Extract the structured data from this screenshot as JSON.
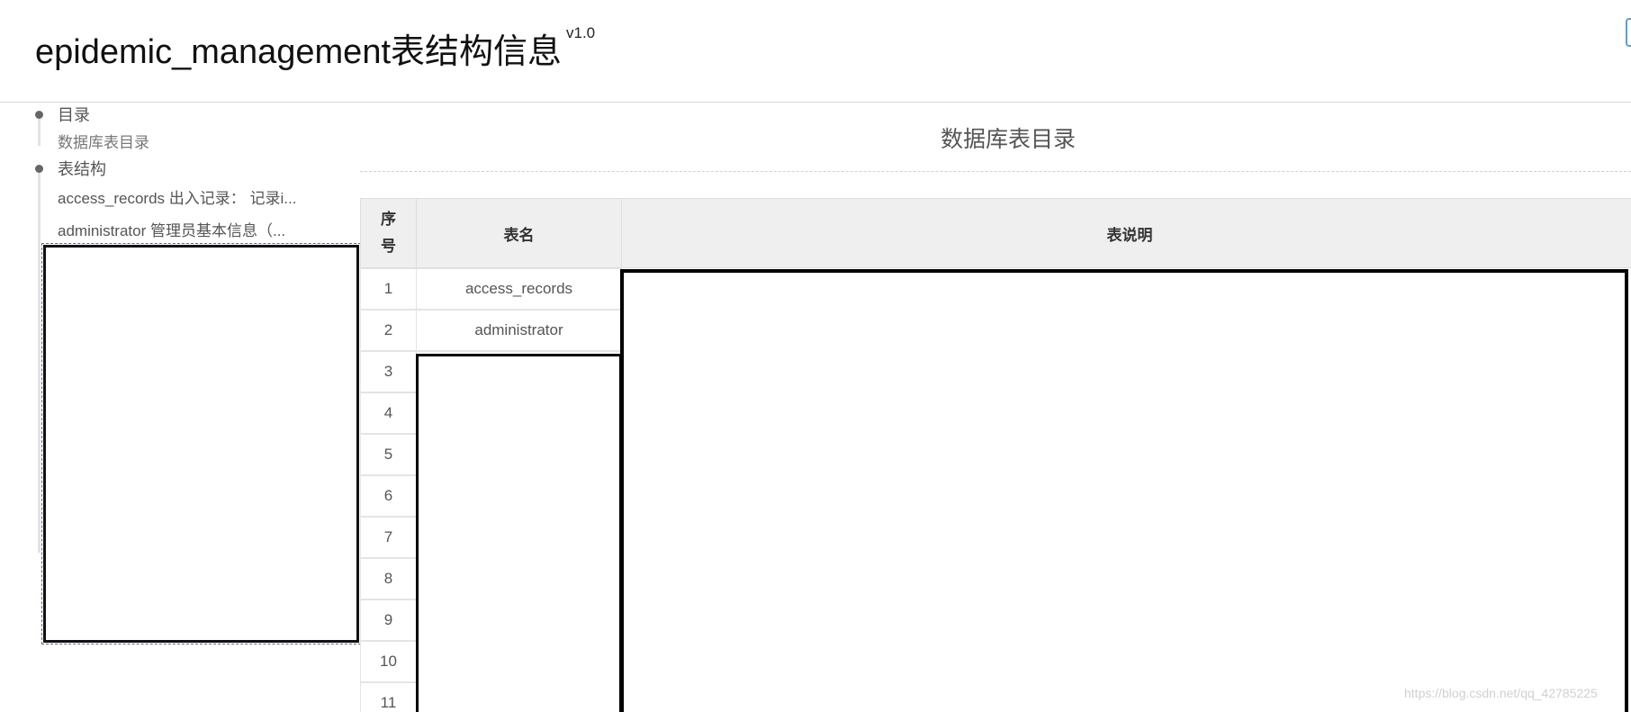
{
  "header": {
    "title": "epidemic_management表结构信息",
    "version": "v1.0"
  },
  "sidebar": {
    "toc_heading": "目录",
    "toc_sub": "数据库表目录",
    "structure_heading": "表结构",
    "items": [
      {
        "label": "access_records 出入记录： 记录i..."
      },
      {
        "label": "administrator 管理员基本信息（..."
      }
    ]
  },
  "main": {
    "title": "数据库表目录",
    "table": {
      "headers": [
        "序号",
        "表名",
        "表说明"
      ],
      "rows": [
        {
          "index": "1",
          "name": "access_records"
        },
        {
          "index": "2",
          "name": "administrator"
        },
        {
          "index": "3",
          "name": ""
        },
        {
          "index": "4",
          "name": ""
        },
        {
          "index": "5",
          "name": ""
        },
        {
          "index": "6",
          "name": ""
        },
        {
          "index": "7",
          "name": ""
        },
        {
          "index": "8",
          "name": ""
        },
        {
          "index": "9",
          "name": ""
        },
        {
          "index": "10",
          "name": ""
        },
        {
          "index": "11",
          "name": ""
        }
      ]
    }
  },
  "watermark": "https://blog.csdn.net/qq_42785225",
  "colors": {
    "header_border": "#d9d9d9",
    "table_header_bg": "#efefef",
    "accent_button": "#5aa0d6"
  }
}
